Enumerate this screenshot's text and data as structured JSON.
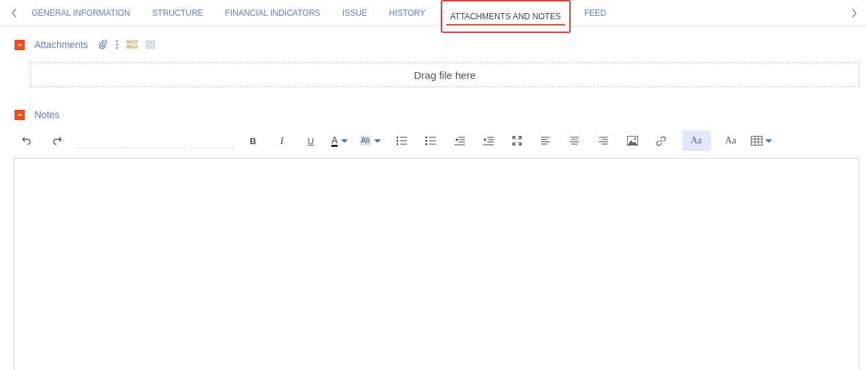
{
  "tabs": [
    {
      "label": "GENERAL INFORMATION",
      "selected": false
    },
    {
      "label": "STRUCTURE",
      "selected": false
    },
    {
      "label": "FINANCIAL INDICATORS",
      "selected": false
    },
    {
      "label": "ISSUE",
      "selected": false
    },
    {
      "label": "HISTORY",
      "selected": false
    },
    {
      "label": "ATTACHMENTS AND NOTES",
      "selected": true
    },
    {
      "label": "FEED",
      "selected": false
    }
  ],
  "attachments": {
    "title": "Attachments",
    "expanded": true,
    "dropzone": "Drag file here"
  },
  "notes": {
    "title": "Notes",
    "expanded": true,
    "toolbar": [
      {
        "kind": "undo"
      },
      {
        "kind": "redo"
      },
      {
        "kind": "font-family"
      },
      {
        "kind": "font-size"
      },
      {
        "kind": "bold",
        "label": "B"
      },
      {
        "kind": "italic",
        "label": "I"
      },
      {
        "kind": "underline",
        "label": "U"
      },
      {
        "kind": "font-color",
        "label": "A"
      },
      {
        "kind": "highlight",
        "label": "Ab"
      },
      {
        "kind": "ordered-list"
      },
      {
        "kind": "bullet-list"
      },
      {
        "kind": "outdent"
      },
      {
        "kind": "indent"
      },
      {
        "kind": "fullscreen"
      },
      {
        "kind": "align-left"
      },
      {
        "kind": "align-center"
      },
      {
        "kind": "align-right"
      },
      {
        "kind": "image"
      },
      {
        "kind": "link"
      },
      {
        "kind": "text-style",
        "label": "Aa",
        "selected": true
      },
      {
        "kind": "text-style",
        "label": "Aa",
        "selected": false
      },
      {
        "kind": "table"
      }
    ]
  }
}
